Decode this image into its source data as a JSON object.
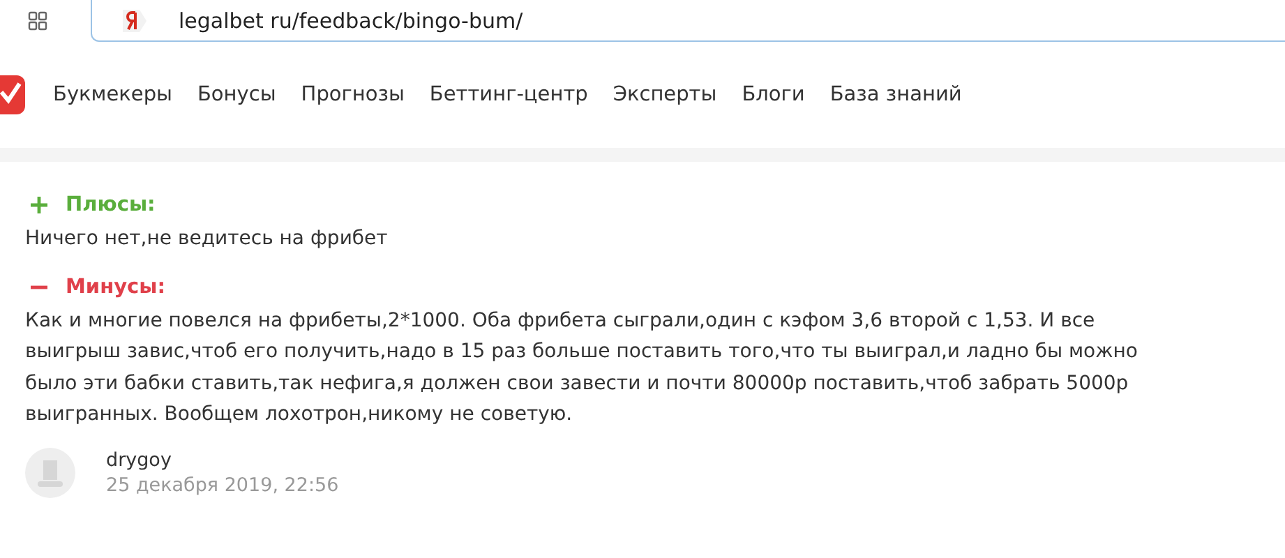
{
  "address_bar": {
    "url": "legalbet ru/feedback/bingo-bum/"
  },
  "nav": {
    "items": [
      "Букмекеры",
      "Бонусы",
      "Прогнозы",
      "Беттинг-центр",
      "Эксперты",
      "Блоги",
      "База знаний"
    ]
  },
  "review": {
    "sections": [
      {
        "kind": "pros",
        "title": "Плюсы:",
        "text": "Ничего нет,не ведитесь на фрибет"
      },
      {
        "kind": "cons",
        "title": "Минусы:",
        "text": "Как и многие повелся на фрибеты,2*1000. Оба фрибета сыграли,один с кэфом 3,6 второй с 1,53. И все выигрыш завис,чтоб его получить,надо в 15 раз больше поставить того,что ты выиграл,и ладно бы можно было эти бабки ставить,так нефига,я должен свои завести и почти 80000р поставить,чтоб забрать 5000р выигранных. Вообщем лохотрон,никому не советую."
      }
    ],
    "author": {
      "name": "drygoy",
      "date": "25 декабря 2019, 22:56"
    }
  }
}
